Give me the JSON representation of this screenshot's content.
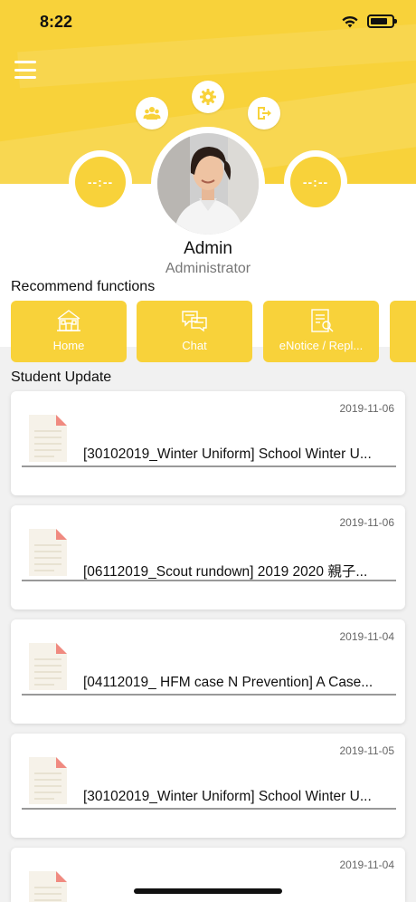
{
  "status_bar": {
    "time": "8:22"
  },
  "header": {
    "icons": [
      "group-icon",
      "gear-icon",
      "logout-icon"
    ],
    "left_badge": "--:--",
    "right_badge": "--:--"
  },
  "profile": {
    "name": "Admin",
    "role": "Administrator"
  },
  "recommend": {
    "title": "Recommend functions",
    "items": [
      {
        "label": "Home",
        "icon": "house-icon"
      },
      {
        "label": "Chat",
        "icon": "chat-icon"
      },
      {
        "label": "eNotice / Repl...",
        "icon": "notice-icon"
      }
    ]
  },
  "student_update": {
    "title": "Student Update",
    "items": [
      {
        "date": "2019-11-06",
        "title": "[30102019_Winter  Uniform] School Winter U..."
      },
      {
        "date": "2019-11-06",
        "title": "[06112019_Scout rundown] 2019 2020 親子..."
      },
      {
        "date": "2019-11-04",
        "title": "[04112019_ HFM case N Prevention] A Case..."
      },
      {
        "date": "2019-11-05",
        "title": "[30102019_Winter  Uniform] School Winter U..."
      },
      {
        "date": "2019-11-04",
        "title": ""
      }
    ]
  },
  "colors": {
    "accent": "#f8d23a",
    "background": "#f1f1f1"
  }
}
